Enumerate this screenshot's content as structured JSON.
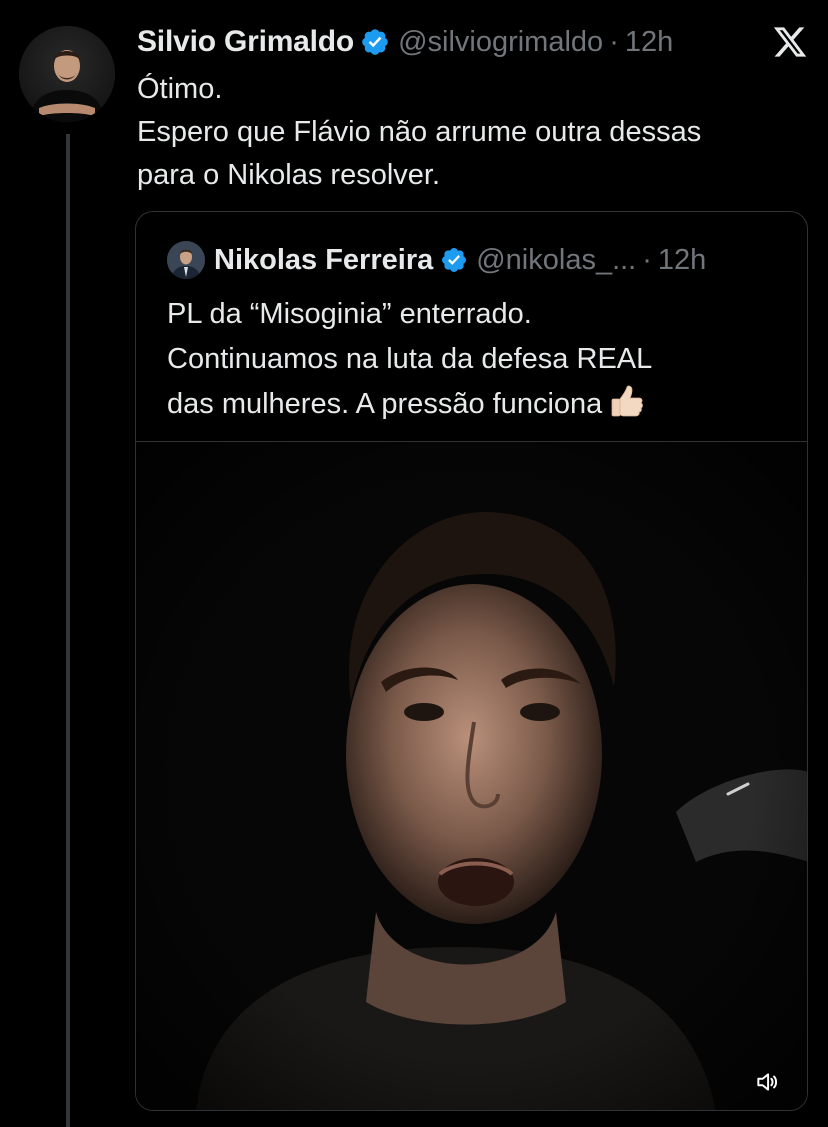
{
  "tweet": {
    "author_name": "Silvio Grimaldo",
    "handle": "@silviogrimaldo",
    "separator": "·",
    "time": "12h",
    "lines": [
      "Ótimo.",
      "Espero que Flávio não arrume outra dessas",
      "para o Nikolas resolver."
    ]
  },
  "quoted_tweet": {
    "author_name": "Nikolas Ferreira",
    "handle": "@nikolas_...",
    "separator": "·",
    "time": "12h",
    "lines": [
      "PL da “Misoginia” enterrado.",
      "Continuamos na luta da defesa REAL",
      "das mulheres. A pressão funciona"
    ],
    "emoji": "thumbs-up-light-skin",
    "media_type": "video"
  },
  "icons": {
    "verified": "verified-badge-icon",
    "brand": "x-logo-icon",
    "volume": "volume-icon"
  },
  "colors": {
    "background": "#000000",
    "text_primary": "#e7e9ea",
    "text_secondary": "#71767b",
    "verified_blue": "#1d9bf0",
    "border": "#2f3336"
  }
}
